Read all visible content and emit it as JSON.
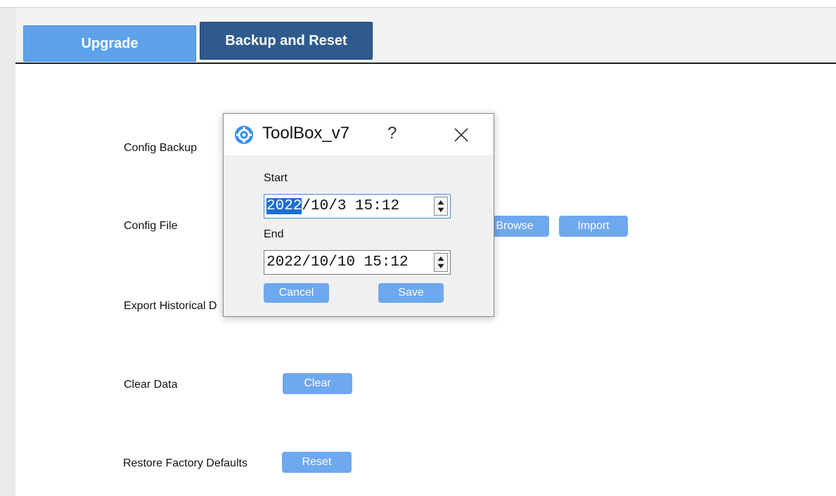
{
  "tabs": [
    {
      "label": "Upgrade"
    },
    {
      "label": "Backup and Reset"
    }
  ],
  "rows": {
    "config_backup": {
      "label": "Config Backup"
    },
    "config_file": {
      "label": "Config File",
      "browse": "Browse",
      "import": "Import"
    },
    "export_history": {
      "label": "Export Historical D"
    },
    "clear_data": {
      "label": "Clear Data",
      "button": "Clear"
    },
    "restore": {
      "label": "Restore Factory Defaults",
      "button": "Reset"
    }
  },
  "dialog": {
    "title": "ToolBox_v7",
    "help": "?",
    "start_label": "Start",
    "start_value_selected": "2022",
    "start_value_rest": "/10/3 15:12",
    "end_label": "End",
    "end_value": "2022/10/10 15:12",
    "cancel": "Cancel",
    "save": "Save"
  },
  "colors": {
    "accent": "#6ea8ee",
    "active_tab": "#2f5a8e",
    "inactive_tab": "#5ea2ec"
  }
}
